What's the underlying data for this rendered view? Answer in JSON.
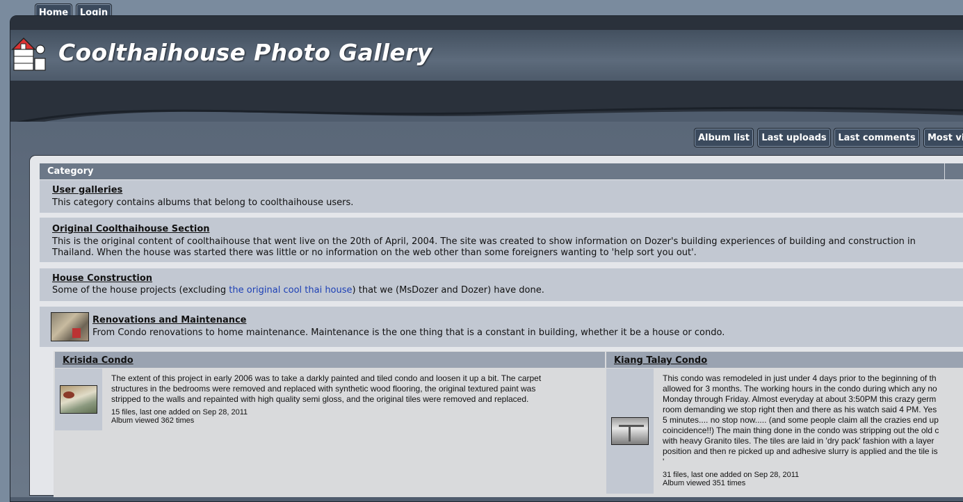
{
  "top_nav": {
    "home": "Home",
    "login": "Login"
  },
  "site_title": "Coolthaihouse Photo Gallery",
  "nav_tabs": [
    "Album list",
    "Last uploads",
    "Last comments",
    "Most vi"
  ],
  "category_header": "Category",
  "categories": [
    {
      "title": "User galleries",
      "desc": "This category contains albums that belong to coolthaihouse users."
    },
    {
      "title": "Original Coolthaihouse Section",
      "desc_line1": "This is the original content of coolthaihouse that went live on the 20th of April, 2004. The site was created to show information on Dozer's building experiences of building and construction in",
      "desc_line2": "Thailand. When the house was started there was little or no information on the web other than some foreigners wanting to 'help sort you out'."
    },
    {
      "title": "House Construction",
      "desc_before": "Some of the house projects (excluding ",
      "desc_link": "the original cool thai house",
      "desc_after": ") that we (MsDozer and Dozer) have done."
    },
    {
      "title": "Renovations and Maintenance",
      "desc": "From Condo renovations to home maintenance. Maintenance is the one thing that is a constant in building, whether it be a house or condo."
    }
  ],
  "albums": [
    {
      "title": "Krisida Condo",
      "lines": [
        "The extent of this project in early 2006 was to take a darkly painted and tiled condo and loosen it up a bit. The carpet",
        "structures in the bedrooms were removed and replaced with synthetic wood flooring, the original textured paint was",
        "stripped to the walls and repainted with high quality semi gloss, and the original tiles were removed and replaced."
      ],
      "files": "15 files, last one added on Sep 28, 2011",
      "views": "Album viewed 362 times"
    },
    {
      "title": "Kiang Talay Condo",
      "lines": [
        "This condo was remodeled in just under 4 days prior to the beginning of th",
        "allowed for 3 months. The working hours in the condo during which any no",
        "Monday through Friday. Almost everyday at about 3:50PM this crazy germ",
        "room demanding we stop right then and there as his watch said 4 PM. Yes",
        "5 minutes.... no stop now..... (and some people claim all the crazies end up",
        "coincidence!!) The main thing done in the condo was stripping out the old c",
        "with heavy Granito tiles. The tiles are laid in 'dry pack' fashion with a layer",
        "position and then re picked up and adhesive slurry is applied and the tile is",
        "'"
      ],
      "files": "31 files, last one added on Sep 28, 2011",
      "views": "Album viewed 351 times"
    }
  ],
  "colors": {
    "nav_button": "#3b4a5d",
    "panel": "#e4e6ea",
    "row": "#c2c8d2",
    "link": "#1d40b5"
  }
}
